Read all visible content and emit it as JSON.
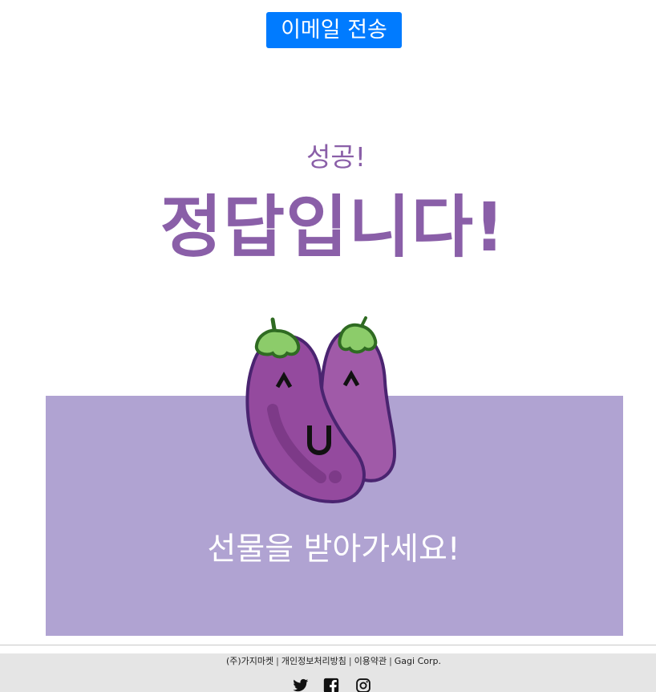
{
  "header": {
    "email_button_label": "이메일 전송"
  },
  "result": {
    "subtitle": "성공!",
    "title": "정답입니다!"
  },
  "gift": {
    "message": "선물을 받아가세요!",
    "mascot_icon": "eggplant-mascot-icon",
    "mascot_face_left": "^ U",
    "mascot_face_right": "^"
  },
  "footer": {
    "links": [
      "(주)가지마켓",
      "개인정보처리방침",
      "이용약관",
      "Gagi Corp."
    ],
    "separator": "|",
    "social_icons": [
      "twitter-icon",
      "facebook-icon",
      "instagram-icon"
    ]
  },
  "colors": {
    "button_blue": "#007bff",
    "accent_purple": "#8a5fa8",
    "panel_lavender": "#b0a3d2",
    "footer_gray": "#e5e5e5"
  }
}
